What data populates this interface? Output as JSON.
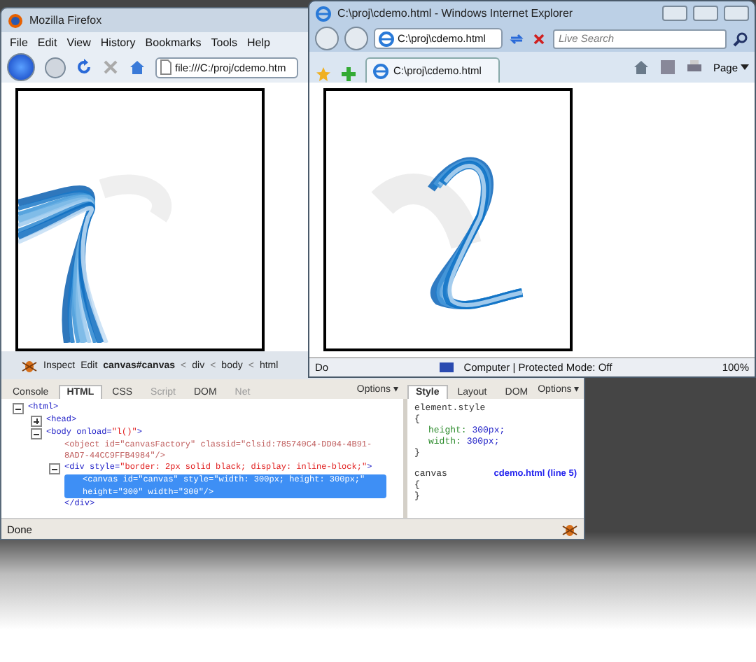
{
  "firefox": {
    "title": "Mozilla Firefox",
    "menu": [
      "File",
      "Edit",
      "View",
      "History",
      "Bookmarks",
      "Tools",
      "Help"
    ],
    "address": "file:///C:/proj/cdemo.htm",
    "firebug": {
      "inspect": "Inspect",
      "edit": "Edit",
      "separator": "<",
      "breadcrumbs": [
        {
          "label": "canvas#canvas",
          "selected": true
        },
        {
          "label": "div",
          "selected": false
        },
        {
          "label": "body",
          "selected": false
        },
        {
          "label": "html",
          "selected": false
        }
      ],
      "tabs": [
        {
          "label": "Console",
          "selected": false,
          "disabled": false
        },
        {
          "label": "HTML",
          "selected": true,
          "disabled": false
        },
        {
          "label": "CSS",
          "selected": false,
          "disabled": false
        },
        {
          "label": "Script",
          "selected": false,
          "disabled": true
        },
        {
          "label": "DOM",
          "selected": false,
          "disabled": false
        },
        {
          "label": "Net",
          "selected": false,
          "disabled": true
        }
      ],
      "options": "Options ▾",
      "tree": [
        {
          "expanded": true,
          "selected": false,
          "segments": [
            {
              "kind": "tag",
              "text": "<html>"
            }
          ],
          "children": [
            {
              "expanded": false,
              "selected": false,
              "segments": [
                {
                  "kind": "tag",
                  "text": "<head>"
                }
              ]
            },
            {
              "expanded": true,
              "selected": false,
              "segments": [
                {
                  "kind": "tag",
                  "text": "<body"
                },
                {
                  "kind": "attr",
                  "text": " onload="
                },
                {
                  "kind": "value",
                  "text": "\"l()\""
                },
                {
                  "kind": "tag",
                  "text": ">"
                }
              ],
              "children": [
                {
                  "selected": false,
                  "segments": [
                    {
                      "kind": "dim",
                      "text": "<object id=\"canvasFactory\" classid=\"clsid:785740C4-DD04-4B91-8AD7-44CC9FFB4984\"/>"
                    }
                  ]
                },
                {
                  "expanded": true,
                  "selected": false,
                  "segments": [
                    {
                      "kind": "tag",
                      "text": "<div"
                    },
                    {
                      "kind": "attr",
                      "text": " style="
                    },
                    {
                      "kind": "value",
                      "text": "\"border: 2px solid black; display: inline-block;\""
                    },
                    {
                      "kind": "tag",
                      "text": ">"
                    }
                  ],
                  "children": [
                    {
                      "selected": true,
                      "segments": [
                        {
                          "kind": "tag",
                          "text": "<canvas id=\"canvas\" style=\"width: 300px; height: 300px;\" height=\"300\" width=\"300\"/>"
                        }
                      ]
                    }
                  ],
                  "closing": "</div>"
                }
              ]
            }
          ]
        }
      ],
      "side_tabs": [
        {
          "label": "Style",
          "selected": true
        },
        {
          "label": "Layout",
          "selected": false
        },
        {
          "label": "DOM",
          "selected": false
        }
      ],
      "side_options": "Options ▾",
      "rules": [
        {
          "selector": "element.style",
          "open": "{",
          "props": [
            {
              "name": "height:",
              "value": "300px;"
            },
            {
              "name": "width:",
              "value": "300px;"
            }
          ],
          "close": "}"
        },
        {
          "selector": "canvas",
          "source": "cdemo.html (line 5)",
          "open": "{",
          "close": "}"
        }
      ]
    },
    "status": "Done"
  },
  "ie": {
    "title": "C:\\proj\\cdemo.html - Windows Internet Explorer",
    "address": "C:\\proj\\cdemo.html",
    "search": {
      "placeholder": "Live Search"
    },
    "tab": "C:\\proj\\cdemo.html",
    "page_menu": "Page",
    "status": "Do",
    "zone": "Computer | Protected Mode: Off",
    "zoom": "100%"
  }
}
